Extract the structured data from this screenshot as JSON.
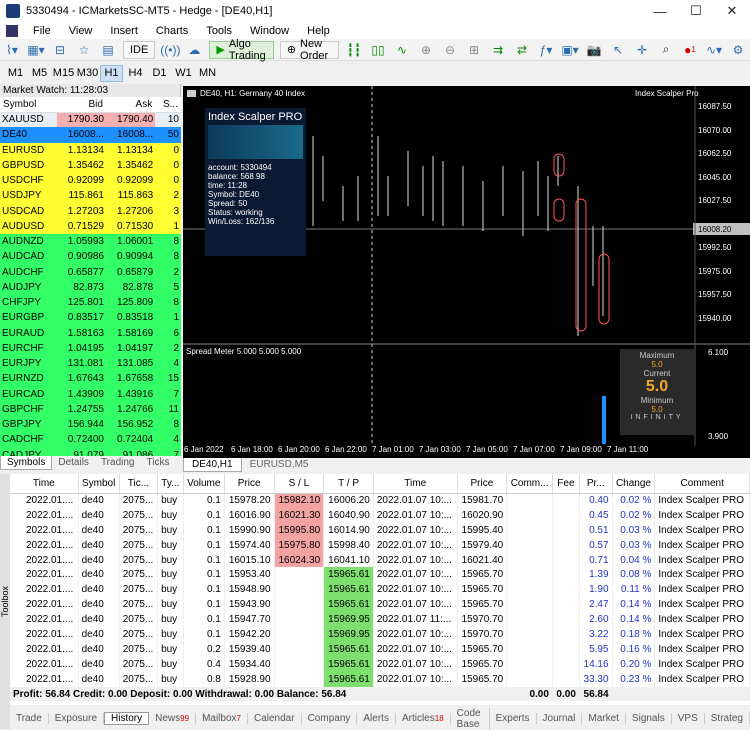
{
  "window": {
    "title": "5330494 - ICMarketsSC-MT5 - Hedge - [DE40,H1]"
  },
  "menu": [
    "File",
    "View",
    "Insert",
    "Charts",
    "Tools",
    "Window",
    "Help"
  ],
  "toolbar": {
    "ide": "IDE",
    "algo": "Algo Trading",
    "neworder": "New Order",
    "alert_count": "1"
  },
  "timeframes": [
    "M1",
    "M5",
    "M15",
    "M30",
    "H1",
    "H4",
    "D1",
    "W1",
    "MN"
  ],
  "selected_tf": "H1",
  "market_watch": {
    "title": "Market Watch: 11:28:03",
    "headers": [
      "Symbol",
      "Bid",
      "Ask",
      "S..."
    ],
    "rows": [
      {
        "sym": "XAUUSD",
        "bid": "1790.30",
        "ask": "1790.40",
        "s": "10",
        "c": "#e8eef8"
      },
      {
        "sym": "DE40",
        "bid": "16008...",
        "ask": "16008...",
        "s": "50",
        "c": "#1e90ff"
      },
      {
        "sym": "EURUSD",
        "bid": "1.13134",
        "ask": "1.13134",
        "s": "0",
        "c": "#ffff33"
      },
      {
        "sym": "GBPUSD",
        "bid": "1.35462",
        "ask": "1.35462",
        "s": "0",
        "c": "#ffff33"
      },
      {
        "sym": "USDCHF",
        "bid": "0.92099",
        "ask": "0.92099",
        "s": "0",
        "c": "#ffff33"
      },
      {
        "sym": "USDJPY",
        "bid": "115.861",
        "ask": "115.863",
        "s": "2",
        "c": "#ffff33"
      },
      {
        "sym": "USDCAD",
        "bid": "1.27203",
        "ask": "1.27206",
        "s": "3",
        "c": "#ffff33"
      },
      {
        "sym": "AUDUSD",
        "bid": "0.71529",
        "ask": "0.71530",
        "s": "1",
        "c": "#ffff33"
      },
      {
        "sym": "AUDNZD",
        "bid": "1.05993",
        "ask": "1.06001",
        "s": "8",
        "c": "#33ff66"
      },
      {
        "sym": "AUDCAD",
        "bid": "0.90986",
        "ask": "0.90994",
        "s": "8",
        "c": "#33ff66"
      },
      {
        "sym": "AUDCHF",
        "bid": "0.65877",
        "ask": "0.65879",
        "s": "2",
        "c": "#33ff66"
      },
      {
        "sym": "AUDJPY",
        "bid": "82.873",
        "ask": "82.878",
        "s": "5",
        "c": "#33ff66"
      },
      {
        "sym": "CHFJPY",
        "bid": "125.801",
        "ask": "125.809",
        "s": "8",
        "c": "#33ff66"
      },
      {
        "sym": "EURGBP",
        "bid": "0.83517",
        "ask": "0.83518",
        "s": "1",
        "c": "#33ff66"
      },
      {
        "sym": "EURAUD",
        "bid": "1.58163",
        "ask": "1.58169",
        "s": "6",
        "c": "#33ff66"
      },
      {
        "sym": "EURCHF",
        "bid": "1.04195",
        "ask": "1.04197",
        "s": "2",
        "c": "#33ff66"
      },
      {
        "sym": "EURJPY",
        "bid": "131.081",
        "ask": "131.085",
        "s": "4",
        "c": "#33ff66"
      },
      {
        "sym": "EURNZD",
        "bid": "1.67643",
        "ask": "1.67658",
        "s": "15",
        "c": "#33ff66"
      },
      {
        "sym": "EURCAD",
        "bid": "1.43909",
        "ask": "1.43916",
        "s": "7",
        "c": "#33ff66"
      },
      {
        "sym": "GBPCHF",
        "bid": "1.24755",
        "ask": "1.24766",
        "s": "11",
        "c": "#33ff66"
      },
      {
        "sym": "GBPJPY",
        "bid": "156.944",
        "ask": "156.952",
        "s": "8",
        "c": "#33ff66"
      },
      {
        "sym": "CADCHF",
        "bid": "0.72400",
        "ask": "0.72404",
        "s": "4",
        "c": "#33ff66"
      },
      {
        "sym": "CADJPY",
        "bid": "91.079",
        "ask": "91.086",
        "s": "7",
        "c": "#33ff66"
      }
    ],
    "tabs": [
      "Symbols",
      "Details",
      "Trading",
      "Ticks"
    ]
  },
  "chart": {
    "header": "DE40, H1:  Germany 40 Index",
    "ea": "Index Scalper PRO",
    "ea_short": "Index Scalper Pro",
    "info": [
      "account: 5330494",
      "balance: 568.98",
      "time: 11:28",
      "Symbol: DE40",
      "Spread: 50",
      "Status: working",
      "Win/Loss: 162/136"
    ],
    "prices": [
      "16087.50",
      "16070.00",
      "16062.50",
      "16045.00",
      "16027.50",
      "16008.20",
      "15992.50",
      "15975.00",
      "15957.50",
      "15940.00"
    ],
    "times": [
      "6 Jan 2022",
      "6 Jan 18:00",
      "6 Jan 20:00",
      "6 Jan 22:00",
      "7 Jan 01:00",
      "7 Jan 03:00",
      "7 Jan 05:00",
      "7 Jan 07:00",
      "7 Jan 09:00",
      "7 Jan 11:00"
    ],
    "sub_label": "Spread Meter 5.000 5.000 5.000",
    "sub_prices": [
      "6.100",
      "3.900"
    ],
    "meter": {
      "max_label": "Maximum",
      "max": "5.0",
      "cur_label": "Current",
      "cur": "5.0",
      "min_label": "Minimum",
      "min": "5.0",
      "brand": "INFINITY"
    },
    "tabs": [
      "DE40,H1",
      "EURUSD,M5"
    ]
  },
  "history": {
    "headers": [
      "Time",
      "Symbol",
      "Tic...",
      "Ty...",
      "Volume",
      "Price",
      "S / L",
      "T / P",
      "Time",
      "Price",
      "Comm...",
      "Fee",
      "Pr...",
      "Change",
      "Comment"
    ],
    "rows": [
      [
        "2022.01....",
        "de40",
        "2075...",
        "buy",
        "0.1",
        "15978.20",
        "15982.10",
        "16006.20",
        "2022.01.07 10:...",
        "15981.70",
        "",
        "",
        "0.40",
        "0.02 %",
        "Index Scalper PRO"
      ],
      [
        "2022.01....",
        "de40",
        "2075...",
        "buy",
        "0.1",
        "16016.90",
        "16021.30",
        "16040.90",
        "2022.01.07 10:...",
        "16020.90",
        "",
        "",
        "0.45",
        "0.02 %",
        "Index Scalper PRO"
      ],
      [
        "2022.01....",
        "de40",
        "2075...",
        "buy",
        "0.1",
        "15990.90",
        "15995.80",
        "16014.90",
        "2022.01.07 10:...",
        "15995.40",
        "",
        "",
        "0.51",
        "0.03 %",
        "Index Scalper PRO"
      ],
      [
        "2022.01....",
        "de40",
        "2075...",
        "buy",
        "0.1",
        "15974.40",
        "15975.80",
        "15998.40",
        "2022.01.07 10:...",
        "15979.40",
        "",
        "",
        "0.57",
        "0.03 %",
        "Index Scalper PRO"
      ],
      [
        "2022.01....",
        "de40",
        "2075...",
        "buy",
        "0.1",
        "16015.10",
        "16024.30",
        "16041.10",
        "2022.01.07 10:...",
        "16021.40",
        "",
        "",
        "0.71",
        "0.04 %",
        "Index Scalper PRO"
      ],
      [
        "2022.01....",
        "de40",
        "2075...",
        "buy",
        "0.1",
        "15953.40",
        "",
        "15965.61",
        "2022.01.07 10:...",
        "15965.70",
        "",
        "",
        "1.39",
        "0.08 %",
        "Index Scalper PRO"
      ],
      [
        "2022.01....",
        "de40",
        "2075...",
        "buy",
        "0.1",
        "15948.90",
        "",
        "15965.61",
        "2022.01.07 10:...",
        "15965.70",
        "",
        "",
        "1.90",
        "0.11 %",
        "Index Scalper PRO"
      ],
      [
        "2022.01....",
        "de40",
        "2075...",
        "buy",
        "0.1",
        "15943.90",
        "",
        "15965.61",
        "2022.01.07 10:...",
        "15965.70",
        "",
        "",
        "2.47",
        "0.14 %",
        "Index Scalper PRO"
      ],
      [
        "2022.01....",
        "de40",
        "2075...",
        "buy",
        "0.1",
        "15947.70",
        "",
        "15969.95",
        "2022.01.07 11:...",
        "15970.70",
        "",
        "",
        "2.60",
        "0.14 %",
        "Index Scalper PRO"
      ],
      [
        "2022.01....",
        "de40",
        "2075...",
        "buy",
        "0.1",
        "15942.20",
        "",
        "15969.95",
        "2022.01.07 10:...",
        "15970.70",
        "",
        "",
        "3.22",
        "0.18 %",
        "Index Scalper PRO"
      ],
      [
        "2022.01....",
        "de40",
        "2075...",
        "buy",
        "0.2",
        "15939.40",
        "",
        "15965.61",
        "2022.01.07 10:...",
        "15965.70",
        "",
        "",
        "5.95",
        "0.16 %",
        "Index Scalper PRO"
      ],
      [
        "2022.01....",
        "de40",
        "2075...",
        "buy",
        "0.4",
        "15934.40",
        "",
        "15965.61",
        "2022.01.07 10:...",
        "15965.70",
        "",
        "",
        "14.16",
        "0.20 %",
        "Index Scalper PRO"
      ],
      [
        "2022.01....",
        "de40",
        "2075...",
        "buy",
        "0.8",
        "15928.90",
        "",
        "15965.61",
        "2022.01.07 10:...",
        "15965.70",
        "",
        "",
        "33.30",
        "0.23 %",
        "Index Scalper PRO"
      ]
    ],
    "sl_red": [
      0,
      1,
      2,
      3,
      4
    ],
    "summary": {
      "text": "Profit: 56.84  Credit: 0.00  Deposit: 0.00  Withdrawal: 0.00  Balance: 56.84",
      "comm": "0.00",
      "fee": "0.00",
      "profit": "56.84"
    }
  },
  "bottom_tabs": [
    {
      "label": "Trade",
      "badge": ""
    },
    {
      "label": "Exposure",
      "badge": ""
    },
    {
      "label": "History",
      "badge": ""
    },
    {
      "label": "News",
      "badge": "99"
    },
    {
      "label": "Mailbox",
      "badge": "7"
    },
    {
      "label": "Calendar",
      "badge": ""
    },
    {
      "label": "Company",
      "badge": ""
    },
    {
      "label": "Alerts",
      "badge": ""
    },
    {
      "label": "Articles",
      "badge": "18"
    },
    {
      "label": "Code Base",
      "badge": ""
    },
    {
      "label": "Experts",
      "badge": ""
    },
    {
      "label": "Journal",
      "badge": ""
    }
  ],
  "bottom_right": [
    "Market",
    "Signals",
    "VPS",
    "Strateg"
  ],
  "toolbox_label": "Toolbox"
}
